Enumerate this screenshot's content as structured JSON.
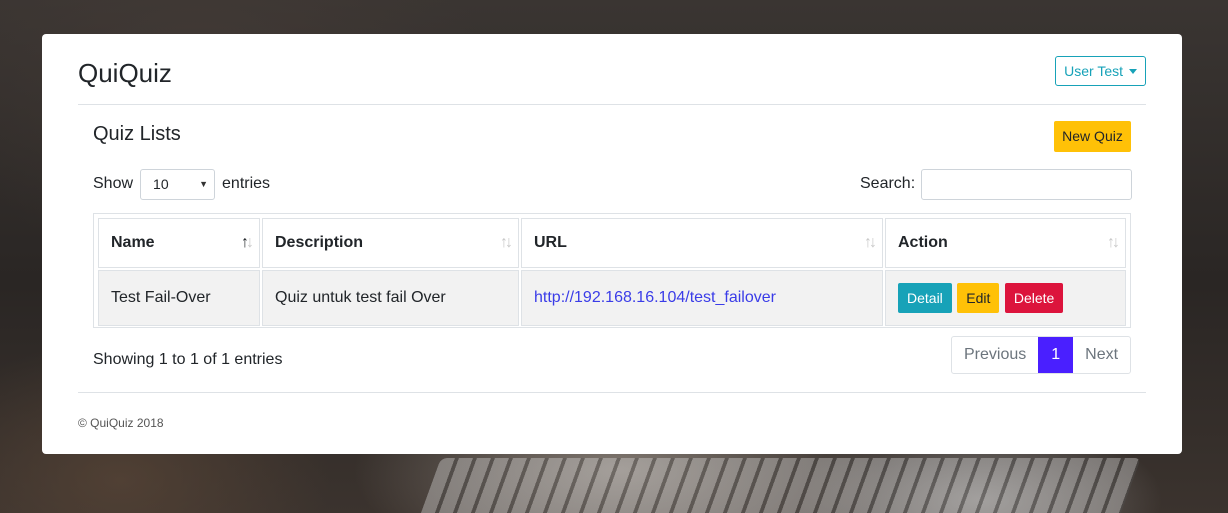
{
  "header": {
    "brand": "QuiQuiz",
    "user_menu_label": "User Test"
  },
  "section": {
    "title": "Quiz Lists",
    "new_quiz_label": "New Quiz"
  },
  "length_control": {
    "prefix": "Show",
    "selected": "10",
    "suffix": "entries"
  },
  "search": {
    "label": "Search:",
    "value": ""
  },
  "table": {
    "columns": [
      "Name",
      "Description",
      "URL",
      "Action"
    ],
    "rows": [
      {
        "name": "Test Fail-Over",
        "description": "Quiz untuk test fail Over",
        "url": "http://192.168.16.104/test_failover",
        "actions": [
          "Detail",
          "Edit",
          "Delete"
        ]
      }
    ]
  },
  "info": "Showing 1 to 1 of 1 entries",
  "pagination": {
    "previous": "Previous",
    "current": "1",
    "next": "Next"
  },
  "footer": "© QuiQuiz 2018",
  "colors": {
    "info": "#17a2b8",
    "warning": "#ffc107",
    "danger": "#dc143c",
    "pagination_active": "#4a1fff",
    "link": "#3a3ce8"
  }
}
